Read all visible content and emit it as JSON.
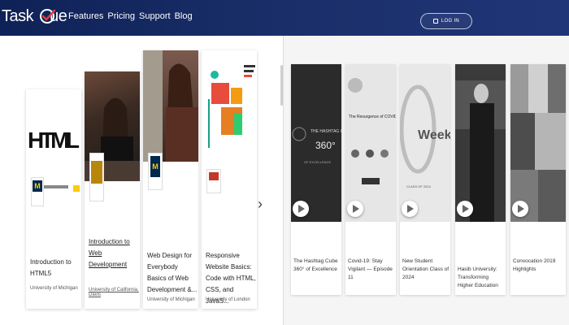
{
  "header": {
    "logo": {
      "part1": "Task",
      "part2": "ue"
    },
    "nav": [
      "Features",
      "Pricing",
      "Support",
      "Blog"
    ],
    "login_label": "LOG IN"
  },
  "courses": [
    {
      "title": "Introduction to HTML5",
      "org": "University of Michigan",
      "thumb_text": "HTML"
    },
    {
      "title": "Introduction to Web Development",
      "org": "University of California, Davis"
    },
    {
      "title": "Web Design for Everybody Basics of Web Development &...",
      "org": "University of Michigan"
    },
    {
      "title": "Responsive Website Basics: Code with HTML, CSS, and JavaS...",
      "org": "University of London"
    }
  ],
  "videos": [
    {
      "title": "The Hashtag Cube 360° of Excellence",
      "thumb_text": "THE HASHTAG CUBE 360° OF EXCELLENCE"
    },
    {
      "title": "Covid-19: Stay Vigilant — Episode 11",
      "thumb_text": "The Resurgence of COVID-19"
    },
    {
      "title": "New Student Orientation Class of 2024",
      "thumb_text": "iWeek"
    },
    {
      "title": "Hasib University: Transforming Higher Education"
    },
    {
      "title": "Convocation 2019 Highlights"
    }
  ],
  "colors": {
    "header_start": "#0f2257",
    "header_end": "#203577",
    "um_blue": "#00274c",
    "um_maize": "#ffcb05"
  },
  "icons": {
    "login": "lock-icon",
    "play": "play-icon",
    "next": "chevron-right-icon"
  }
}
